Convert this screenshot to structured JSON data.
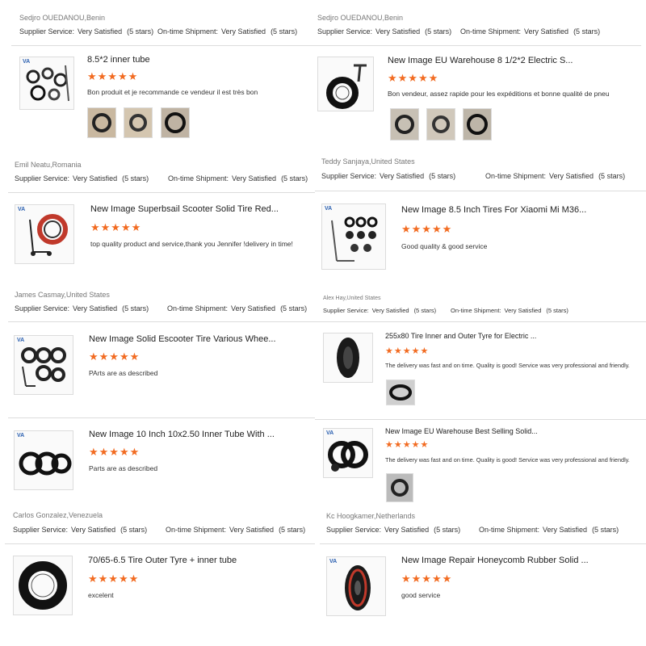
{
  "labels": {
    "supplier_service": "Supplier Service:",
    "ontime_shipment": "On-time Shipment:",
    "very_satisfied": "Very Satisfied",
    "five_stars": "(5 stars)",
    "stars_glyphs": "★★★★★"
  },
  "reviews_left": [
    {
      "reviewer": "Sedjro OUEDANOU,Benin",
      "title": "8.5*2 inner tube",
      "comment": "Bon produit et je recommande ce vendeur il est très bon",
      "rating": 5,
      "photos": 3
    },
    {
      "reviewer": "Emil Neatu,Romania",
      "title": "New Image Superbsail Scooter Solid Tire Red...",
      "comment": "top quality product and service,thank you Jennifer !delivery in time!",
      "rating": 5,
      "photos": 0
    },
    {
      "reviewer": "James Casmay,United States",
      "title": "New Image Solid Escooter Tire Various Whee...",
      "comment": "PArts are as described",
      "rating": 5,
      "photos": 0
    },
    {
      "reviewer": "",
      "title": "New Image 10 Inch 10x2.50 Inner Tube With ...",
      "comment": "Parts are as described",
      "rating": 5,
      "photos": 0
    },
    {
      "reviewer": "Carlos Gonzalez,Venezuela",
      "title": "70/65-6.5 Tire Outer Tyre + inner tube",
      "comment": "excelent",
      "rating": 5,
      "photos": 0
    }
  ],
  "reviews_right": [
    {
      "reviewer": "Sedjro OUEDANOU,Benin",
      "title": "New Image EU Warehouse 8 1/2*2 Electric S...",
      "comment": "Bon vendeur, assez rapide pour les expéditions et bonne qualité de pneu",
      "rating": 5,
      "photos": 3
    },
    {
      "reviewer": "Teddy Sanjaya,United States",
      "title": "New Image 8.5 Inch Tires For Xiaomi Mi M36...",
      "comment": "Good quality & good service",
      "rating": 5,
      "photos": 0
    },
    {
      "reviewer": "Alex Hay,United States",
      "title": "255x80 Tire Inner and Outer Tyre for Electric ...",
      "comment": "The delivery was fast and on time. Quality is good! Service was very professional and friendly.",
      "rating": 5,
      "photos": 1
    },
    {
      "reviewer": "",
      "title": "New Image EU Warehouse Best Selling Solid...",
      "comment": "The delivery was fast and on time. Quality is good! Service was very professional and friendly.",
      "rating": 5,
      "photos": 1
    },
    {
      "reviewer": "Kc Hoogkamer,Netherlands",
      "title": "New Image Repair Honeycomb Rubber Solid ...",
      "comment": "good service",
      "rating": 5,
      "photos": 0
    }
  ],
  "colors": {
    "star": "#f26b21",
    "separator": "#dcdcdc",
    "brand_logo": "#2a5fb0"
  }
}
